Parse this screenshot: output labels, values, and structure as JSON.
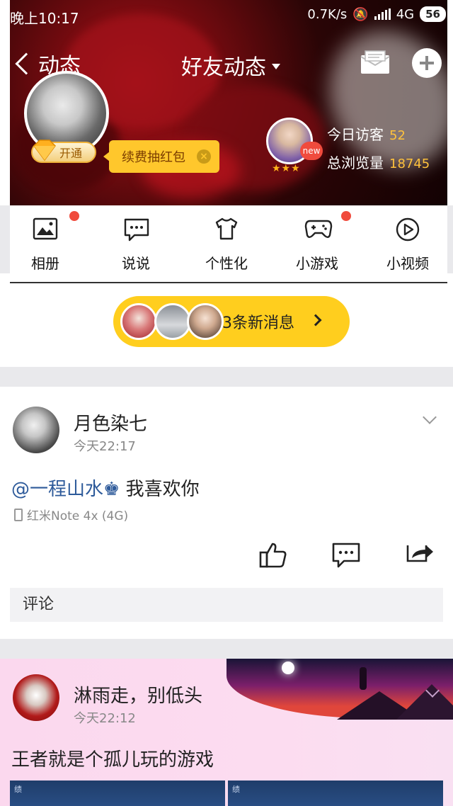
{
  "status_bar": {
    "time": "晚上10:17",
    "speed": "0.7K/s",
    "network": "4G",
    "battery": "56"
  },
  "nav": {
    "back_label": "动态",
    "title": "好友动态"
  },
  "profile": {
    "vip_label": "开通",
    "redpack_label": "续费抽红包",
    "visitor_new": "new",
    "stars": "★★★",
    "today_visitors_label": "今日访客",
    "today_visitors": "52",
    "total_views_label": "总浏览量",
    "total_views": "18745"
  },
  "shortcuts": [
    {
      "label": "相册",
      "icon": "album-icon",
      "dot": true
    },
    {
      "label": "说说",
      "icon": "chat-icon",
      "dot": false
    },
    {
      "label": "个性化",
      "icon": "shirt-icon",
      "dot": false
    },
    {
      "label": "小游戏",
      "icon": "gamepad-icon",
      "dot": true
    },
    {
      "label": "小视频",
      "icon": "play-icon",
      "dot": false
    }
  ],
  "new_messages": {
    "label": "3条新消息"
  },
  "posts": [
    {
      "author": "月色染七",
      "time": "今天22:17",
      "mention": "@一程山水♚",
      "text": " 我喜欢你",
      "device": "红米Note 4x (4G)",
      "comment_placeholder": "评论"
    },
    {
      "author": "淋雨走，别低头",
      "time": "今天22:12",
      "text": "王者就是个孤儿玩的游戏",
      "thumb_text": "绩"
    }
  ],
  "colors": {
    "accent_yellow": "#ffce1e",
    "badge_red": "#f04b3d",
    "link_blue": "#2d5a9a",
    "stat_gold": "#ffc23c"
  }
}
